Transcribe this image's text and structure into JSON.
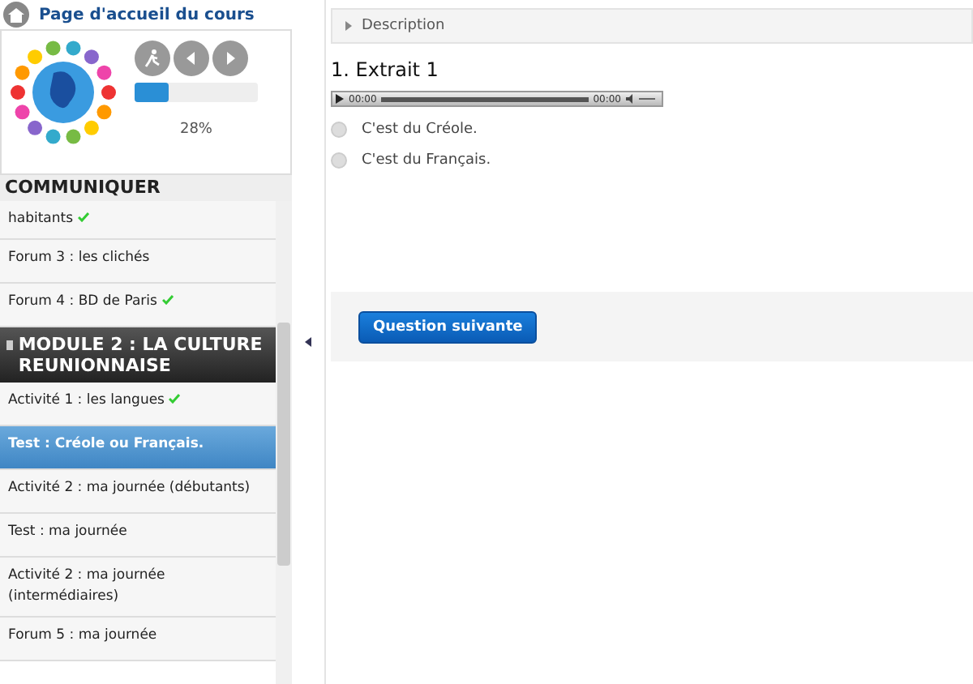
{
  "sidebar": {
    "home_link": "Page d'accueil du cours",
    "progress": {
      "level": 0.28,
      "reading": "28%"
    },
    "section_title": "COMMUNIQUER",
    "items": [
      {
        "kind": "activity",
        "label": "habitants",
        "done": true,
        "selected": false
      },
      {
        "kind": "activity",
        "label": "Forum 3 : les clichés",
        "done": false,
        "selected": false
      },
      {
        "kind": "activity",
        "label": "Forum 4 : BD de Paris",
        "done": true,
        "selected": false
      },
      {
        "kind": "module",
        "label": "MODULE 2 : LA CULTURE REUNIONNAISE"
      },
      {
        "kind": "activity",
        "label": "Activité 1 : les langues",
        "done": true,
        "selected": false
      },
      {
        "kind": "activity",
        "label": "Test : Créole ou Français.",
        "done": false,
        "selected": true
      },
      {
        "kind": "activity",
        "label": "Activité 2 : ma journée (débutants)",
        "done": false,
        "selected": false
      },
      {
        "kind": "activity",
        "label": "Test : ma journée",
        "done": false,
        "selected": false
      },
      {
        "kind": "activity",
        "label": "Activité 2 : ma journée (intermédiaires)",
        "done": false,
        "selected": false
      },
      {
        "kind": "activity",
        "label": "Forum 5 : ma journée",
        "done": false,
        "selected": false
      }
    ]
  },
  "content": {
    "description": "Description",
    "question_title": "1. Extrait 1",
    "player": {
      "current_time": "00:00",
      "duration": "00:00"
    },
    "options": [
      {
        "label": "C'est du Créole.",
        "selected": false
      },
      {
        "label": "C'est du Français.",
        "selected": false
      }
    ],
    "next_button": "Question suivante"
  }
}
